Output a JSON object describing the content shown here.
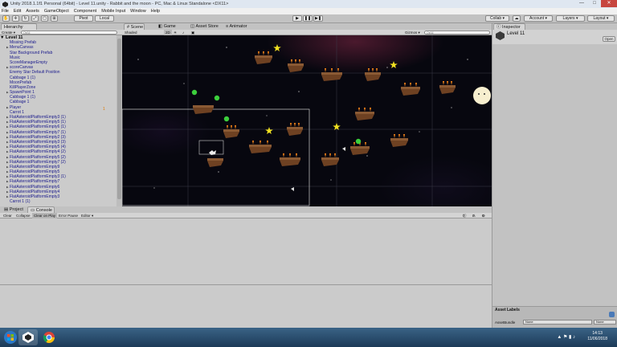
{
  "window": {
    "title": "Unity 2018.1.1f1 Personal (64bit) - Level 11.unity - Rabbit and the moon - PC, Mac & Linux Standalone <DX11>",
    "min": "—",
    "max": "□",
    "close": "✕"
  },
  "menu": [
    "File",
    "Edit",
    "Assets",
    "GameObject",
    "Component",
    "Mobile Input",
    "Window",
    "Help"
  ],
  "toolbar": {
    "pivot": "Pivot",
    "local": "Local",
    "play": "▶",
    "pause": "❚❚",
    "step": "▶❚",
    "collab": "Collab ▾",
    "account": "Account ▾",
    "layers": "Layers ▾",
    "layout": "Layout ▾"
  },
  "hierarchy": {
    "tab": "Hierarchy",
    "create": "Create ▾",
    "search_placeholder": "Q▾All",
    "root": "Level 11",
    "items": [
      {
        "label": "Missing Prefab",
        "expandable": false
      },
      {
        "label": "MenuCanvas",
        "expandable": true
      },
      {
        "label": "Star Background Prefab",
        "expandable": false
      },
      {
        "label": "Music",
        "expandable": false
      },
      {
        "label": "ScoreManagerEmpty",
        "expandable": false
      },
      {
        "label": "scoreCanvas",
        "expandable": true
      },
      {
        "label": "Enemy Star Default Position",
        "expandable": false
      },
      {
        "label": "Cabbage 1 (1)",
        "expandable": false
      },
      {
        "label": "MoonPrefab",
        "expandable": false
      },
      {
        "label": "KillPlayerZone",
        "expandable": false
      },
      {
        "label": "SpawnPoint 1",
        "expandable": true
      },
      {
        "label": "Cabbage 1 (1)",
        "expandable": false
      },
      {
        "label": "Cabbage 1",
        "expandable": false
      },
      {
        "label": "Player",
        "expandable": true
      },
      {
        "label": "Carrot 1",
        "expandable": false
      },
      {
        "label": "FlatAsteroidPlatformEmpty3 (1)",
        "expandable": true
      },
      {
        "label": "FlatAsteroidPlatformEmpty5 (1)",
        "expandable": true
      },
      {
        "label": "FlatAsteroidPlatformEmpty6 (1)",
        "expandable": true
      },
      {
        "label": "FlatAsteroidPlatformEmpty7 (1)",
        "expandable": true
      },
      {
        "label": "FlatAsteroidPlatformEmpty2 (3)",
        "expandable": true
      },
      {
        "label": "FlatAsteroidPlatformEmpty3 (3)",
        "expandable": true
      },
      {
        "label": "FlatAsteroidPlatformEmpty5 (4)",
        "expandable": true
      },
      {
        "label": "FlatAsteroidPlatformEmpty4 (2)",
        "expandable": true
      },
      {
        "label": "FlatAsteroidPlatformEmpty5 (2)",
        "expandable": true
      },
      {
        "label": "FlatAsteroidPlatformEmpty7 (2)",
        "expandable": true
      },
      {
        "label": "FlatAsteroidPlatformEmpty9",
        "expandable": true
      },
      {
        "label": "FlatAsteroidPlatformEmpty5",
        "expandable": true
      },
      {
        "label": "FlatAsteroidPlatformEmpty3 (1)",
        "expandable": true
      },
      {
        "label": "FlatAsteroidPlatformEmpty7",
        "expandable": true
      },
      {
        "label": "FlatAsteroidPlatformEmpty6",
        "expandable": true
      },
      {
        "label": "FlatAsteroidPlatformEmpty4",
        "expandable": true
      },
      {
        "label": "FlatAsteroidPlatformEmpty3",
        "expandable": true
      },
      {
        "label": "Carrot 1 (1)",
        "expandable": false
      }
    ],
    "player_badge": "1"
  },
  "scene": {
    "tabs": [
      "Scene",
      "Game",
      "Asset Store",
      "Animator"
    ],
    "shading": "Shaded",
    "mode_2d": "2D",
    "gizmos": "Gizmos ▾",
    "search_placeholder": "Q▾All"
  },
  "console": {
    "tabs": [
      "Project",
      "Console"
    ],
    "buttons": [
      "Clear",
      "Collapse",
      "Clear on Play",
      "Error Pause",
      "Editor ▾"
    ],
    "counts": [
      "0",
      "0",
      "0"
    ]
  },
  "inspector": {
    "tab": "Inspector",
    "object_name": "Level 11",
    "open_button": "Open",
    "asset_labels": "Asset Labels",
    "assetbundle_label": "AssetBundle",
    "assetbundle_value": "None",
    "assetbundle_variant": "None"
  },
  "taskbar": {
    "time": "14:13",
    "date": "11/06/2018"
  },
  "colors": {
    "accent_star": "#f0e020",
    "cabbage": "#3ccf3c",
    "platform": "#6e4122",
    "carrot": "#ff8a1a"
  }
}
